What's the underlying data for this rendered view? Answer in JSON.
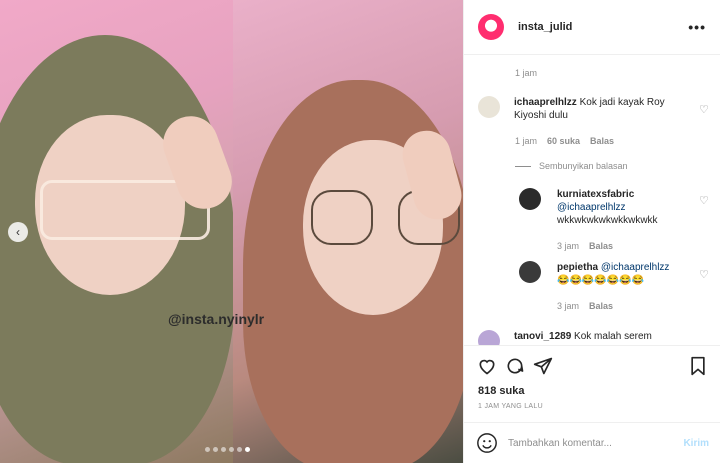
{
  "post": {
    "watermark": "@insta.nyinylr",
    "carousel_index": 6,
    "carousel_total": 6
  },
  "header": {
    "username": "insta_julid",
    "more_label": "•••"
  },
  "comments": {
    "top_timestamp": "1 jam",
    "items": [
      {
        "username": "ichaaprelhlzz",
        "text": "Kok jadi kayak Roy Kiyoshi dulu",
        "time": "1 jam",
        "likes": "60 suka",
        "reply_label": "Balas",
        "hide_replies": "Sembunyikan balasan",
        "replies": [
          {
            "username": "kurniatexsfabric",
            "mention": "@ichaaprelhlzz",
            "text": "wkkwkwkwkwkkwkwkk",
            "time": "3 jam",
            "reply_label": "Balas"
          },
          {
            "username": "pepietha",
            "mention": "@ichaaprelhlzz",
            "text": "😂😂😂😂😂😂😂",
            "time": "3 jam",
            "reply_label": "Balas"
          }
        ]
      },
      {
        "username": "tanovi_1289",
        "text": "Kok malah serem"
      }
    ]
  },
  "actions": {
    "likes": "818 suka",
    "posted": "1 JAM YANG LALU"
  },
  "composer": {
    "placeholder": "Tambahkan komentar...",
    "send_label": "Kirim"
  },
  "colors": {
    "accent": "#ff2d6f",
    "link": "#00376b",
    "muted": "#8e8e8e",
    "send_disabled": "#b2dffc"
  }
}
